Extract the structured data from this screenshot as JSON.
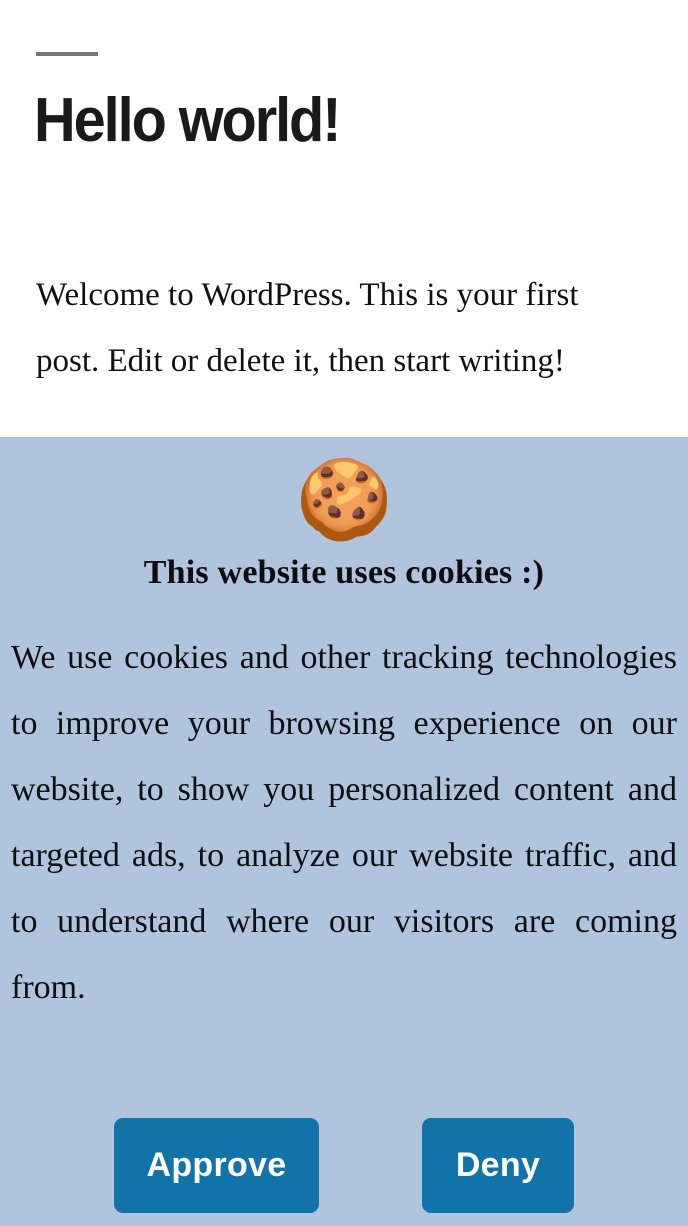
{
  "page": {
    "divider": "",
    "post": {
      "title": "Hello world!",
      "body": "Welcome to WordPress. This is your first post. Edit or delete it, then start writing!"
    }
  },
  "cookie_banner": {
    "emoji": "🍪",
    "emoji_name": "cookie-icon",
    "heading": "This website uses cookies :)",
    "body": "We use cookies and other tracking technologies to improve your browsing experience on our website, to show you personalized content and targeted ads, to analyze our website traffic, and to understand where our visitors are coming from.",
    "approve_label": "Approve",
    "deny_label": "Deny",
    "colors": {
      "background": "#b0c4de",
      "button": "#1273a8",
      "button_text": "#ffffff",
      "text": "#0f0f0f"
    }
  }
}
